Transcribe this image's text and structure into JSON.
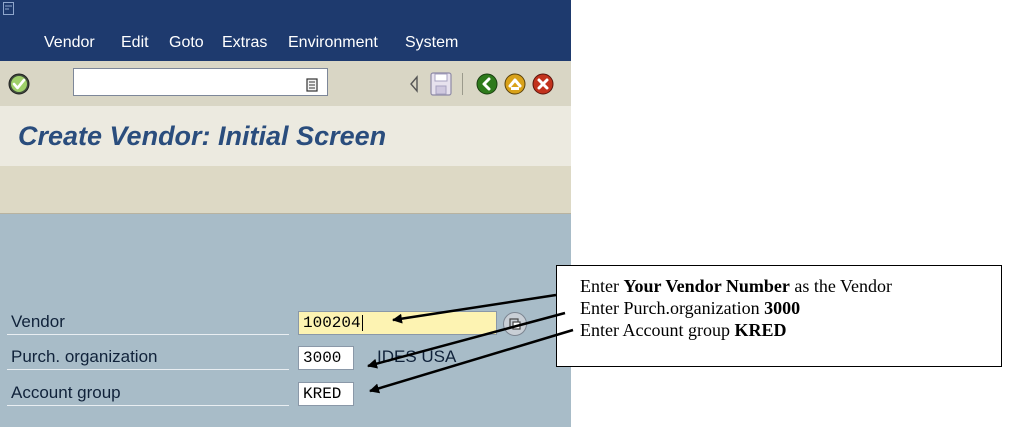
{
  "menubar": {
    "items": [
      "Vendor",
      "Edit",
      "Goto",
      "Extras",
      "Environment",
      "System"
    ],
    "background": "#1e3a6e"
  },
  "toolbar": {
    "icons": [
      "enter-check-icon",
      "command-list-icon",
      "back-triangle-icon",
      "save-icon",
      "back-green-icon",
      "exit-yellow-icon",
      "cancel-red-icon"
    ]
  },
  "screen": {
    "title": "Create Vendor: Initial Screen"
  },
  "form": {
    "vendor": {
      "label": "Vendor",
      "value": "100204"
    },
    "purch_org": {
      "label": "Purch. organization",
      "value": "3000",
      "description": "IDES USA"
    },
    "account_group": {
      "label": "Account group",
      "value": "KRED"
    }
  },
  "callout": {
    "line1_prefix": "Enter ",
    "line1_bold": "Your Vendor Number",
    "line1_suffix": " as the Vendor",
    "line2_prefix": "Enter Purch.organization ",
    "line2_bold": "3000",
    "line3_prefix": "Enter Account group ",
    "line3_bold": "KRED"
  },
  "colors": {
    "title": "#2a4d7d",
    "content_bg": "#a8bcc8",
    "input_yellow": "#fdf3b2"
  }
}
